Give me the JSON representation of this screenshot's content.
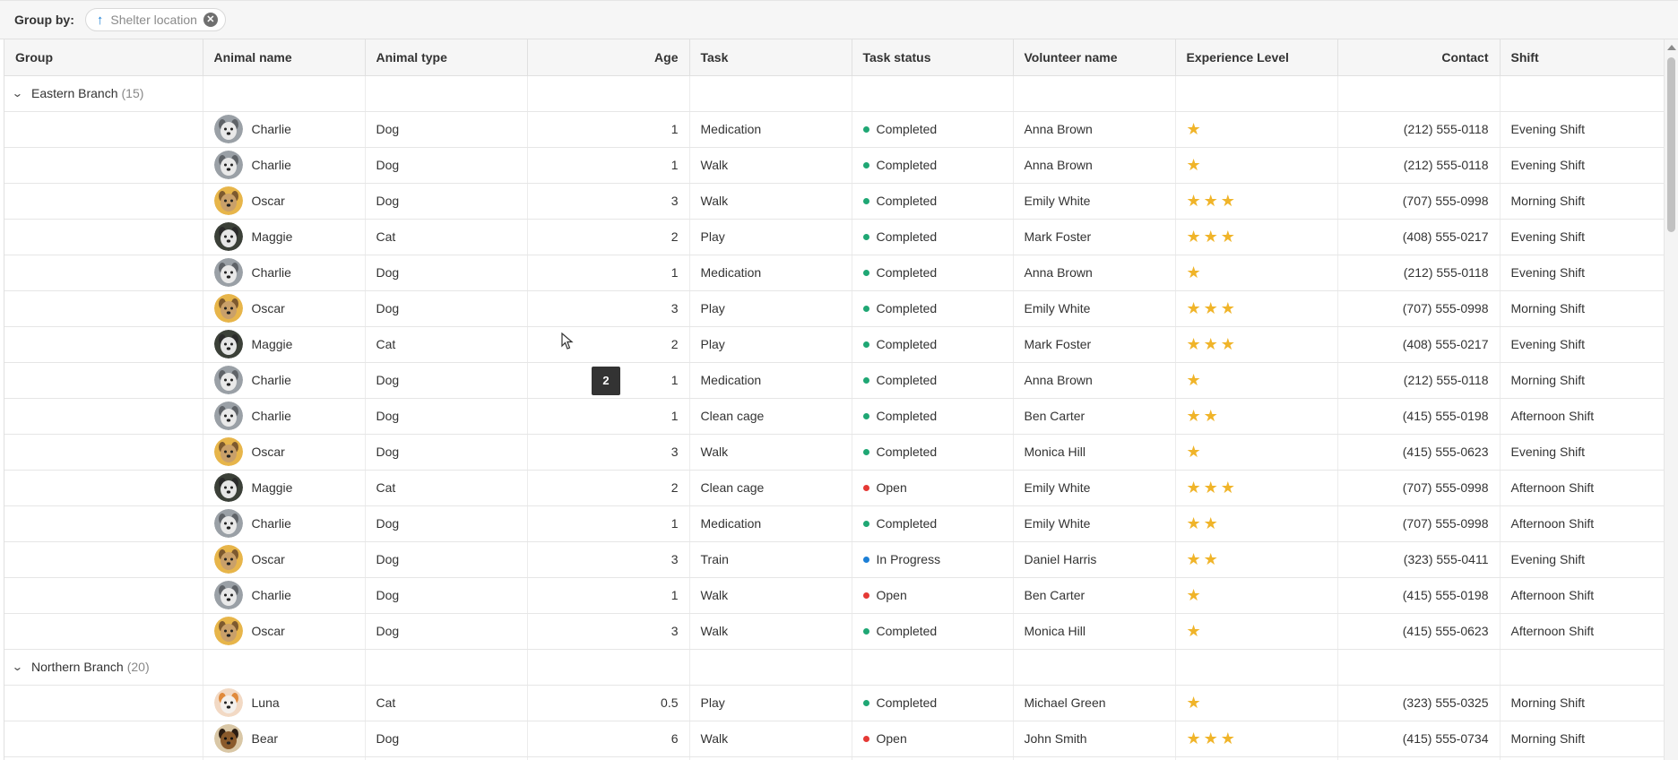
{
  "group_bar": {
    "label": "Group by:",
    "chip_text": "Shelter location",
    "chip_icon": "arrow-up-icon",
    "remove_icon": "close-circle-icon"
  },
  "columns": [
    {
      "key": "group",
      "label": "Group",
      "align": "left"
    },
    {
      "key": "name",
      "label": "Animal name",
      "align": "left"
    },
    {
      "key": "type",
      "label": "Animal type",
      "align": "left"
    },
    {
      "key": "age",
      "label": "Age",
      "align": "right"
    },
    {
      "key": "task",
      "label": "Task",
      "align": "left"
    },
    {
      "key": "status",
      "label": "Task status",
      "align": "left"
    },
    {
      "key": "volunteer",
      "label": "Volunteer name",
      "align": "left"
    },
    {
      "key": "experience",
      "label": "Experience Level",
      "align": "left"
    },
    {
      "key": "contact",
      "label": "Contact",
      "align": "right"
    },
    {
      "key": "shift",
      "label": "Shift",
      "align": "left"
    }
  ],
  "status_colors": {
    "Completed": "#1fa774",
    "Open": "#e53935",
    "In Progress": "#1c7fd6"
  },
  "groups": [
    {
      "name": "Eastern Branch",
      "count": "(15)",
      "rows": [
        {
          "name": "Charlie",
          "avatar": "dog-gray",
          "type": "Dog",
          "age": "1",
          "task": "Medication",
          "status": "Completed",
          "volunteer": "Anna Brown",
          "stars": 1,
          "contact": "(212) 555-0118",
          "shift": "Evening Shift"
        },
        {
          "name": "Charlie",
          "avatar": "dog-gray",
          "type": "Dog",
          "age": "1",
          "task": "Walk",
          "status": "Completed",
          "volunteer": "Anna Brown",
          "stars": 1,
          "contact": "(212) 555-0118",
          "shift": "Evening Shift"
        },
        {
          "name": "Oscar",
          "avatar": "dog-yellow",
          "type": "Dog",
          "age": "3",
          "task": "Walk",
          "status": "Completed",
          "volunteer": "Emily White",
          "stars": 3,
          "contact": "(707) 555-0998",
          "shift": "Morning Shift"
        },
        {
          "name": "Maggie",
          "avatar": "cat-dark",
          "type": "Cat",
          "age": "2",
          "task": "Play",
          "status": "Completed",
          "volunteer": "Mark Foster",
          "stars": 3,
          "contact": "(408) 555-0217",
          "shift": "Evening Shift"
        },
        {
          "name": "Charlie",
          "avatar": "dog-gray",
          "type": "Dog",
          "age": "1",
          "task": "Medication",
          "status": "Completed",
          "volunteer": "Anna Brown",
          "stars": 1,
          "contact": "(212) 555-0118",
          "shift": "Evening Shift"
        },
        {
          "name": "Oscar",
          "avatar": "dog-yellow",
          "type": "Dog",
          "age": "3",
          "task": "Play",
          "status": "Completed",
          "volunteer": "Emily White",
          "stars": 3,
          "contact": "(707) 555-0998",
          "shift": "Morning Shift"
        },
        {
          "name": "Maggie",
          "avatar": "cat-dark",
          "type": "Cat",
          "age": "2",
          "task": "Play",
          "status": "Completed",
          "volunteer": "Mark Foster",
          "stars": 3,
          "contact": "(408) 555-0217",
          "shift": "Evening Shift"
        },
        {
          "name": "Charlie",
          "avatar": "dog-gray",
          "type": "Dog",
          "age": "1",
          "task": "Medication",
          "status": "Completed",
          "volunteer": "Anna Brown",
          "stars": 1,
          "contact": "(212) 555-0118",
          "shift": "Morning Shift"
        },
        {
          "name": "Charlie",
          "avatar": "dog-gray",
          "type": "Dog",
          "age": "1",
          "task": "Clean cage",
          "status": "Completed",
          "volunteer": "Ben Carter",
          "stars": 2,
          "contact": "(415) 555-0198",
          "shift": "Afternoon Shift"
        },
        {
          "name": "Oscar",
          "avatar": "dog-yellow",
          "type": "Dog",
          "age": "3",
          "task": "Walk",
          "status": "Completed",
          "volunteer": "Monica Hill",
          "stars": 1,
          "contact": "(415) 555-0623",
          "shift": "Evening Shift"
        },
        {
          "name": "Maggie",
          "avatar": "cat-dark",
          "type": "Cat",
          "age": "2",
          "task": "Clean cage",
          "status": "Open",
          "volunteer": "Emily White",
          "stars": 3,
          "contact": "(707) 555-0998",
          "shift": "Afternoon Shift"
        },
        {
          "name": "Charlie",
          "avatar": "dog-gray",
          "type": "Dog",
          "age": "1",
          "task": "Medication",
          "status": "Completed",
          "volunteer": "Emily White",
          "stars": 2,
          "contact": "(707) 555-0998",
          "shift": "Afternoon Shift"
        },
        {
          "name": "Oscar",
          "avatar": "dog-yellow",
          "type": "Dog",
          "age": "3",
          "task": "Train",
          "status": "In Progress",
          "volunteer": "Daniel Harris",
          "stars": 2,
          "contact": "(323) 555-0411",
          "shift": "Evening Shift"
        },
        {
          "name": "Charlie",
          "avatar": "dog-gray",
          "type": "Dog",
          "age": "1",
          "task": "Walk",
          "status": "Open",
          "volunteer": "Ben Carter",
          "stars": 1,
          "contact": "(415) 555-0198",
          "shift": "Afternoon Shift"
        },
        {
          "name": "Oscar",
          "avatar": "dog-yellow",
          "type": "Dog",
          "age": "3",
          "task": "Walk",
          "status": "Completed",
          "volunteer": "Monica Hill",
          "stars": 1,
          "contact": "(415) 555-0623",
          "shift": "Afternoon Shift"
        }
      ]
    },
    {
      "name": "Northern Branch",
      "count": "(20)",
      "rows": [
        {
          "name": "Luna",
          "avatar": "cat-orange",
          "type": "Cat",
          "age": "0.5",
          "task": "Play",
          "status": "Completed",
          "volunteer": "Michael Green",
          "stars": 1,
          "contact": "(323) 555-0325",
          "shift": "Morning Shift"
        },
        {
          "name": "Bear",
          "avatar": "dog-brown",
          "type": "Dog",
          "age": "6",
          "task": "Walk",
          "status": "Open",
          "volunteer": "John Smith",
          "stars": 3,
          "contact": "(415) 555-0734",
          "shift": "Morning Shift"
        },
        {
          "name": "",
          "avatar": "",
          "type": "",
          "age": "",
          "task": "",
          "status": "",
          "volunteer": "",
          "stars": 0,
          "contact": "",
          "shift": ""
        }
      ]
    }
  ],
  "drag_badge": "2",
  "star_glyph": "★"
}
